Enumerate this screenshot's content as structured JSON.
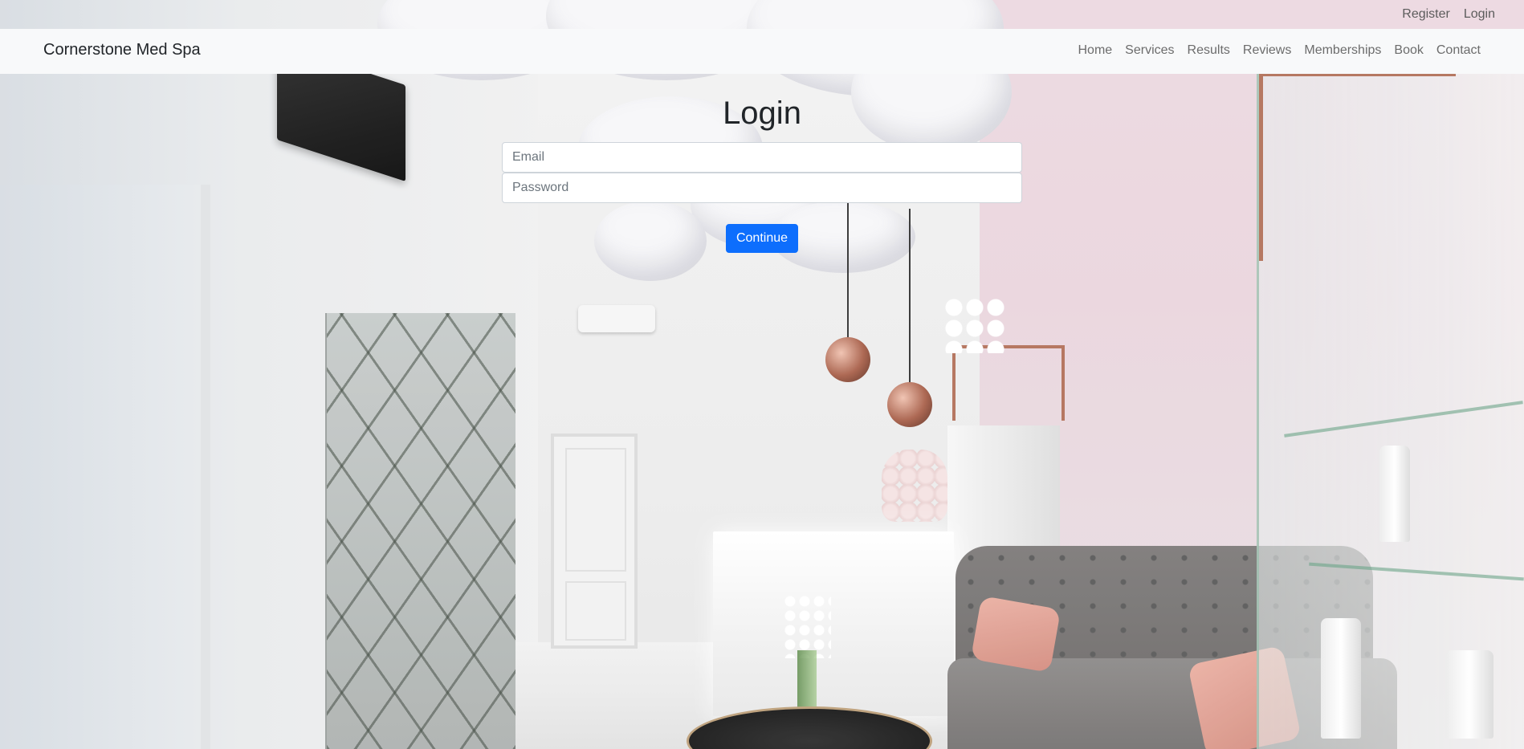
{
  "topbar": {
    "links": [
      "Register",
      "Login"
    ]
  },
  "navbar": {
    "brand": "Cornerstone Med Spa",
    "items": [
      "Home",
      "Services",
      "Results",
      "Reviews",
      "Memberships",
      "Book",
      "Contact"
    ]
  },
  "login": {
    "title": "Login",
    "email_placeholder": "Email",
    "email_value": "",
    "password_placeholder": "Password",
    "password_value": "",
    "continue_label": "Continue"
  },
  "colors": {
    "navbar_bg": "#f8f9fa",
    "primary_button": "#0d6efd",
    "text_dark": "#212529",
    "nav_link": "#6c6c6c"
  },
  "background": {
    "description_icon": "spa-interior-photo"
  }
}
